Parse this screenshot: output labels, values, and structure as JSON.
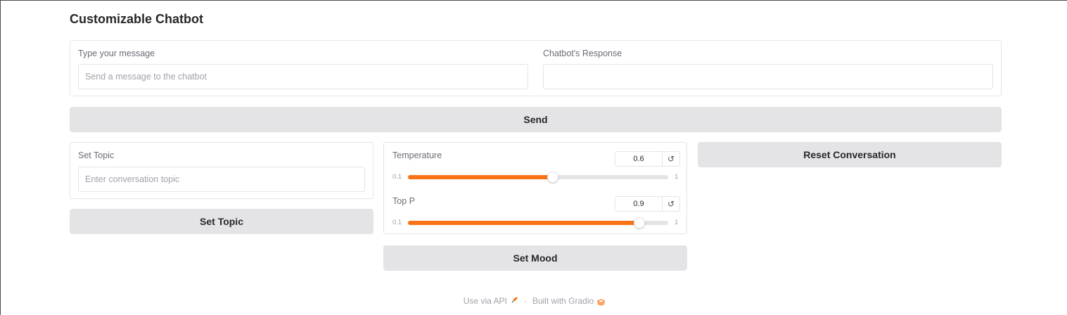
{
  "app": {
    "title": "Customizable Chatbot"
  },
  "chat": {
    "message_label": "Type your message",
    "message_placeholder": "Send a message to the chatbot",
    "message_value": "",
    "response_label": "Chatbot's Response",
    "response_value": "",
    "send_label": "Send"
  },
  "topic": {
    "label": "Set Topic",
    "placeholder": "Enter conversation topic",
    "value": "",
    "button_label": "Set Topic"
  },
  "sliders": [
    {
      "label": "Temperature",
      "value": "0.6",
      "min": "0.1",
      "max": "1",
      "reset_icon": "↺",
      "fraction": 0.556
    },
    {
      "label": "Top P",
      "value": "0.9",
      "min": "0.1",
      "max": "1",
      "reset_icon": "↺",
      "fraction": 0.889
    }
  ],
  "mood": {
    "button_label": "Set Mood"
  },
  "reset": {
    "button_label": "Reset Conversation"
  },
  "footer": {
    "api_label": "Use via API",
    "separator": "·",
    "built_label": "Built with Gradio"
  },
  "colors": {
    "accent": "#f97316",
    "button_bg": "#e4e4e7",
    "border": "#e4e4e7"
  }
}
